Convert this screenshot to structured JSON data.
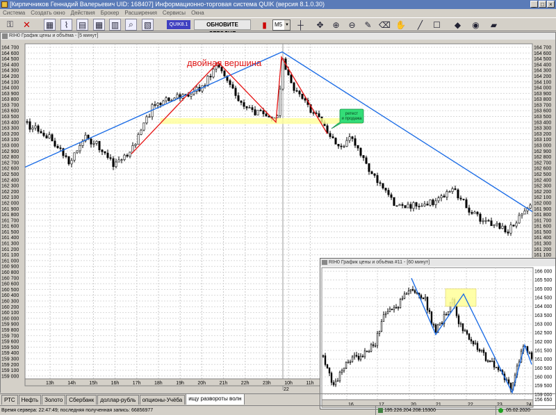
{
  "window": {
    "title": "[Кирпичников Геннадий Валерьевич UID: 168407] Информационно-торговая система QUIK (версия 8.1.0.30)",
    "controls": [
      "_",
      "□",
      "×"
    ]
  },
  "menu": {
    "items": [
      "Система",
      "Создать окно",
      "Действия",
      "Брокер",
      "Расширения",
      "Сервисы",
      "Окна"
    ]
  },
  "toolbar": {
    "quik_label": "QUIK8.1",
    "update_label": "ОБНОВИТЕ СЕГОДНЯ",
    "timeframe": "M5"
  },
  "main_chart": {
    "header": "RIH0 График цены и объёма - [5 минут]",
    "annotation": "двойная вершина",
    "callout": [
      "ретест",
      "и продажа"
    ],
    "date_marker": "22",
    "colors": {
      "trend": "#1e6ee6",
      "pattern": "#e61e1e",
      "zone": "#ffff9a",
      "callout": "#33dd77"
    }
  },
  "sub_chart": {
    "header": "RIH0 График цены и объёма #11 - [60 минут]"
  },
  "chart_data": [
    {
      "type": "candlestick",
      "y_ticks": [
        164700,
        164600,
        164500,
        164400,
        164300,
        164200,
        164100,
        164000,
        163900,
        163800,
        163700,
        163600,
        163500,
        163400,
        163300,
        163200,
        163100,
        163000,
        162900,
        162800,
        162700,
        162600,
        162500,
        162400,
        162300,
        162200,
        162100,
        162000,
        161900,
        161800,
        161700,
        161600,
        161500,
        161400,
        161300,
        161200,
        161100,
        161000,
        160900,
        160800,
        160700,
        160600,
        160500,
        160400,
        160300,
        160200,
        160100,
        160000,
        159900,
        159800,
        159700,
        159600,
        159500,
        159400,
        159300,
        159200,
        159100,
        159000
      ],
      "ylim": [
        158950,
        164760
      ],
      "x_ticks": [
        "13h",
        "14h",
        "15h",
        "16h",
        "17h",
        "18h",
        "19h",
        "20h",
        "21h",
        "22h",
        "23h",
        "10h",
        "11h"
      ]
    },
    {
      "type": "candlestick",
      "y_ticks": [
        166000,
        165500,
        165000,
        164500,
        164000,
        163500,
        163000,
        162500,
        162000,
        161500,
        161000,
        160500,
        160000,
        159500,
        159000
      ],
      "ylim": [
        158700,
        166200
      ],
      "x_ticks": [
        "16",
        "17",
        "20",
        "21",
        "22",
        "23",
        "24"
      ],
      "bottom_label": "156 650"
    }
  ],
  "tabs": {
    "items": [
      "РТС",
      "Нефть",
      "Золото",
      "Сбербанк",
      "доллар-рубль",
      "опционы-Учёба",
      "ищу развороты волн"
    ],
    "active": 6
  },
  "status": {
    "text": "Время сервера: 22:47:49; последняя полученная запись: 66856977",
    "address": "195.226.204.208:15300",
    "date": "05.02.2020"
  }
}
